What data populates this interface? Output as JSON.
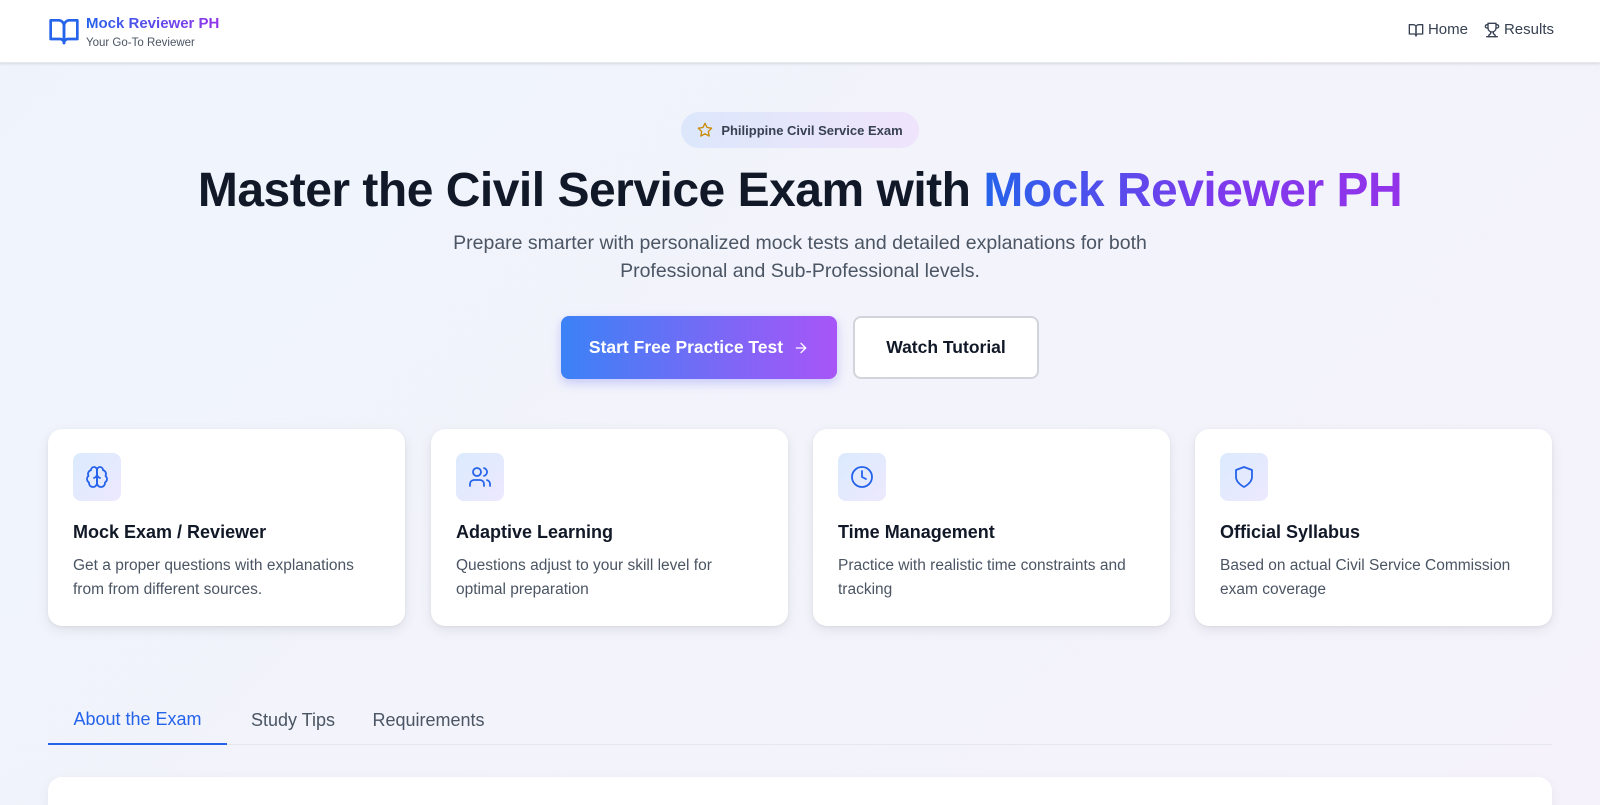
{
  "header": {
    "brand_title": "Mock Reviewer PH",
    "brand_subtitle": "Your Go-To Reviewer",
    "nav": [
      {
        "label": "Home",
        "icon": "book-open-icon"
      },
      {
        "label": "Results",
        "icon": "trophy-icon"
      }
    ]
  },
  "hero": {
    "badge": "Philippine Civil Service Exam",
    "badge_icon": "star-icon",
    "title_prefix": "Master the Civil Service Exam with ",
    "title_highlight": "Mock Reviewer PH",
    "description": "Prepare smarter with personalized mock tests and detailed explanations for both Professional and Sub-Professional levels.",
    "primary_button": "Start Free Practice Test",
    "secondary_button": "Watch Tutorial"
  },
  "features": [
    {
      "icon": "brain-icon",
      "title": "Mock Exam / Reviewer",
      "description": "Get a proper questions with explanations from from different sources."
    },
    {
      "icon": "users-icon",
      "title": "Adaptive Learning",
      "description": "Questions adjust to your skill level for optimal preparation"
    },
    {
      "icon": "clock-icon",
      "title": "Time Management",
      "description": "Practice with realistic time constraints and tracking"
    },
    {
      "icon": "shield-icon",
      "title": "Official Syllabus",
      "description": "Based on actual Civil Service Commission exam coverage"
    }
  ],
  "tabs": [
    {
      "label": "About the Exam",
      "active": true
    },
    {
      "label": "Study Tips",
      "active": false
    },
    {
      "label": "Requirements",
      "active": false
    }
  ],
  "colors": {
    "primary": "#2563eb",
    "accent": "#9333ea",
    "gradient_start": "#3b82f6",
    "gradient_end": "#a855f7"
  }
}
